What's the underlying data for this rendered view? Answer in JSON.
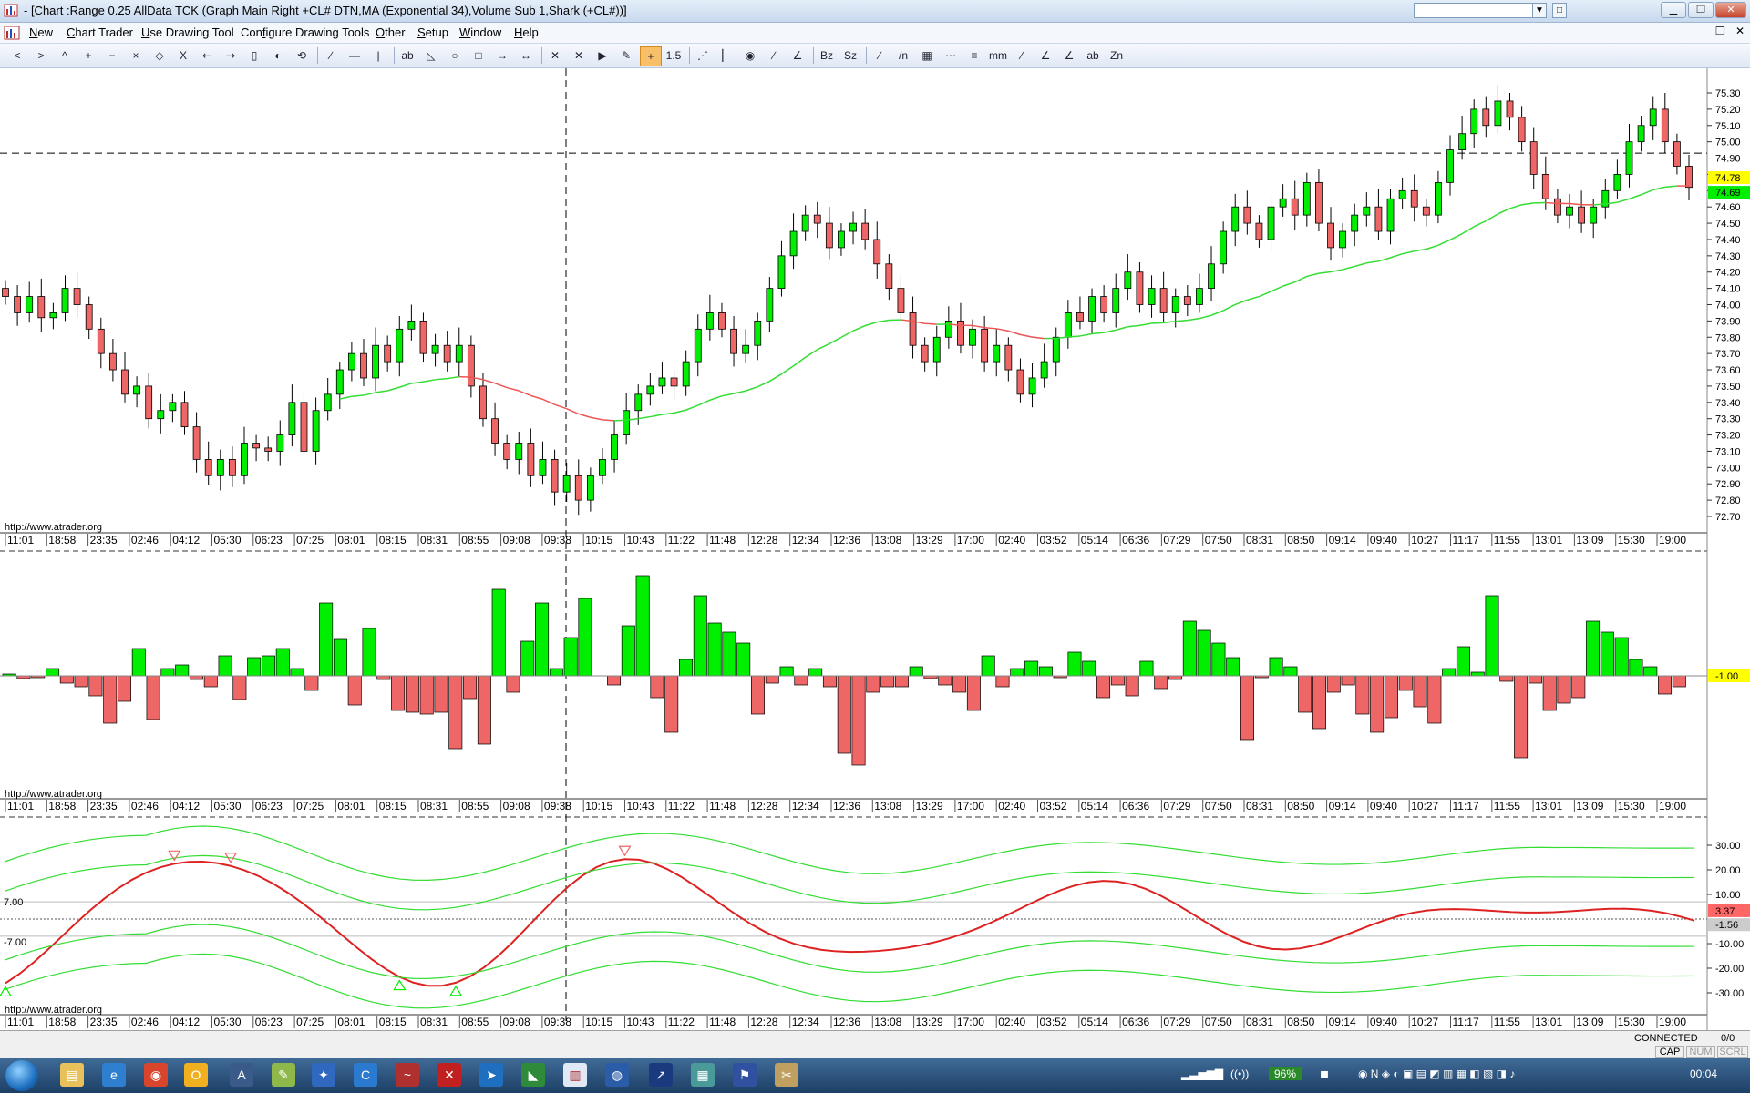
{
  "window": {
    "title": "- [Chart :Range 0.25 AllData TCK (Graph Main Right +CL# DTN,MA (Exponential 34),Volume Sub 1,Shark (+CL#))]"
  },
  "menu": {
    "items": [
      {
        "label": "New",
        "key": "N"
      },
      {
        "label": "Chart Trader",
        "key": "C"
      },
      {
        "label": "Use Drawing Tool",
        "key": "U"
      },
      {
        "label": "Configure Drawing Tools",
        "key": "f"
      },
      {
        "label": "Other",
        "key": "O"
      },
      {
        "label": "Setup",
        "key": "S"
      },
      {
        "label": "Window",
        "key": "W"
      },
      {
        "label": "Help",
        "key": "H"
      }
    ]
  },
  "toolbar": {
    "buttons": [
      "<",
      ">",
      "^",
      "+",
      "−",
      "×",
      "◇",
      "X",
      "⇠",
      "⇢",
      "▯",
      "◐",
      "⟲",
      "∕",
      "—",
      "|",
      "ab",
      "◺",
      "○",
      "□",
      "→",
      "↔",
      "✕",
      "✕",
      "▶",
      "✎",
      "+",
      "1.5",
      "⋰",
      "▏",
      "◉",
      "∕",
      "∠",
      "Bz",
      "Sz",
      "∕",
      "/n",
      "▦",
      "⋯",
      "≡",
      "mm",
      "∕",
      "∠",
      "∠",
      "ab",
      "Zn"
    ]
  },
  "chart": {
    "watermark": "http://www.atrader.org",
    "time_labels": [
      "11:01",
      "18:58",
      "23:35",
      "02:46",
      "04:12",
      "05:30",
      "06:23",
      "07:25",
      "08:01",
      "08:15",
      "08:31",
      "08:55",
      "09:08",
      "09:38",
      "10:15",
      "10:43",
      "11:22",
      "11:48",
      "12:28",
      "12:34",
      "12:36",
      "13:08",
      "13:29",
      "17:00",
      "02:40",
      "03:52",
      "05:14",
      "06:36",
      "07:29",
      "07:50",
      "08:31",
      "08:50",
      "09:14",
      "09:40",
      "10:27",
      "11:17",
      "11:55",
      "13:01",
      "13:09",
      "15:30",
      "19:00"
    ],
    "price_axis_labels": [
      "75.30",
      "75.20",
      "75.10",
      "75.00",
      "74.90",
      "74.80",
      "74.70",
      "74.60",
      "74.50",
      "74.40",
      "74.30",
      "74.20",
      "74.10",
      "74.00",
      "73.90",
      "73.80",
      "73.70",
      "73.60",
      "73.50",
      "73.40",
      "73.30",
      "73.20",
      "73.10",
      "73.00",
      "72.90",
      "72.80",
      "72.70"
    ],
    "last_price_label": "74.78",
    "ma_price_label": "74.69",
    "volume_value_label": "-1.00",
    "shark_axis_labels": [
      "30.00",
      "20.00",
      "10.00",
      "-10.00",
      "-20.00",
      "-30.00"
    ],
    "shark_left_labels": [
      "7.00",
      "-7.00"
    ],
    "shark_value_label": "3.37",
    "shark_value_label2": "-1.56",
    "colors": {
      "up": "#00ee00",
      "down": "#ee6666",
      "ma": "#33dd33",
      "ma_below": "#ee5555",
      "osc": "#dd2222",
      "band": "#33dd33",
      "crosshair": "#000000",
      "lastprice_bg": "#ffff00",
      "ma_bg": "#00ee00"
    }
  },
  "status": {
    "connection": "CONNECTED",
    "counter": "0/0",
    "keys": [
      "CAP",
      "NUM",
      "SCRL"
    ]
  },
  "taskbar": {
    "tray_percent": "96%",
    "clock": "00:04"
  }
}
